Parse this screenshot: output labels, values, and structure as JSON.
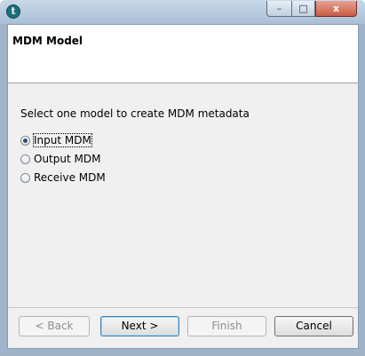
{
  "window": {
    "icon": "talend-icon",
    "caption_buttons": {
      "minimize": "–",
      "maximize": "□",
      "close": "x"
    }
  },
  "header": {
    "title": "MDM Model"
  },
  "main": {
    "prompt": "Select one model to create MDM metadata",
    "options": [
      {
        "label": "Input MDM",
        "checked": true
      },
      {
        "label": "Output MDM",
        "checked": false
      },
      {
        "label": "Receive MDM",
        "checked": false
      }
    ]
  },
  "footer": {
    "back_label": "< Back",
    "next_label": "Next >",
    "finish_label": "Finish",
    "cancel_label": "Cancel"
  }
}
